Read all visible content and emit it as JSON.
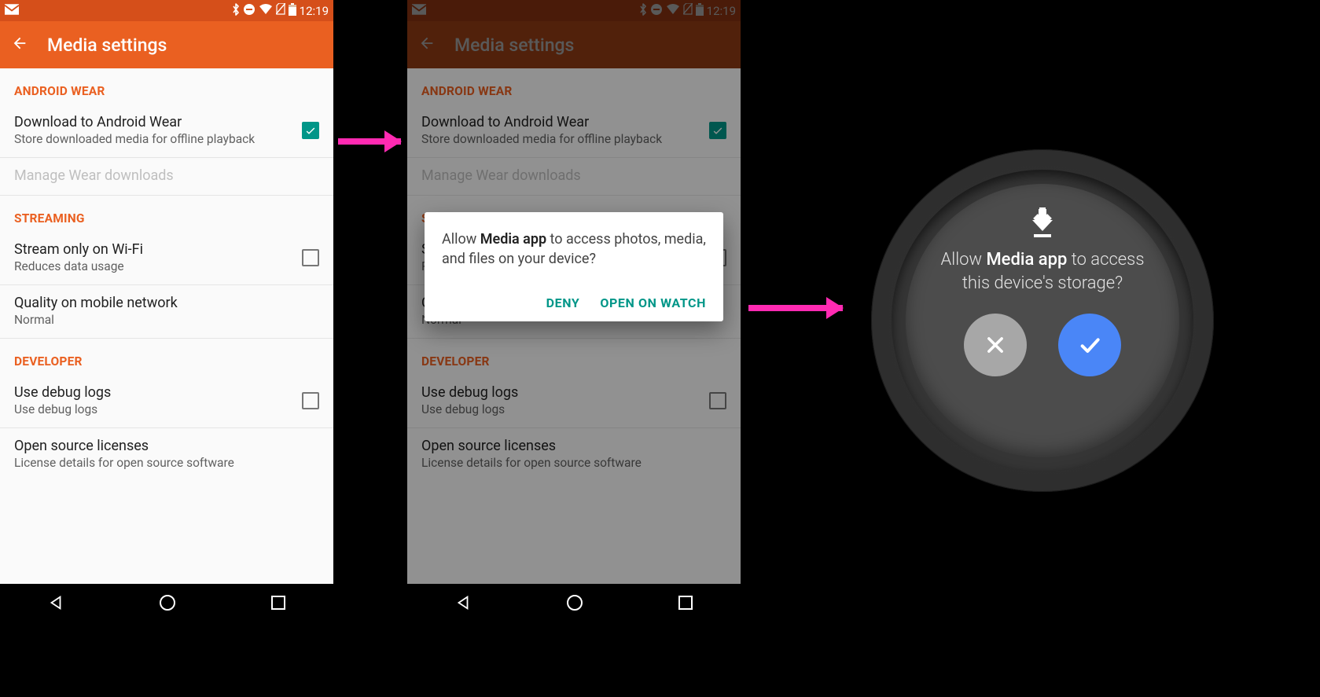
{
  "statusbar": {
    "time": "12:19"
  },
  "appbar": {
    "title": "Media settings"
  },
  "sections": {
    "wear": {
      "header": "ANDROID WEAR",
      "download": {
        "title": "Download to Android Wear",
        "sub": "Store downloaded media for offline playback"
      },
      "manage": {
        "title": "Manage Wear downloads"
      }
    },
    "streaming": {
      "header": "STREAMING",
      "wifi": {
        "title": "Stream only on Wi-Fi",
        "sub": "Reduces data usage"
      },
      "quality": {
        "title": "Quality on mobile network",
        "sub": "Normal"
      }
    },
    "developer": {
      "header": "DEVELOPER",
      "debug": {
        "title": "Use debug logs",
        "sub": "Use debug logs"
      },
      "oss": {
        "title": "Open source licenses",
        "sub": "License details for open source software"
      }
    }
  },
  "dialog": {
    "prefix": "Allow ",
    "app": "Media app",
    "suffix": " to access photos, media, and files on your device?",
    "deny": "DENY",
    "open": "OPEN ON WATCH"
  },
  "watch": {
    "prefix": "Allow ",
    "app": "Media app",
    "suffix": "  to access this device's storage?"
  }
}
